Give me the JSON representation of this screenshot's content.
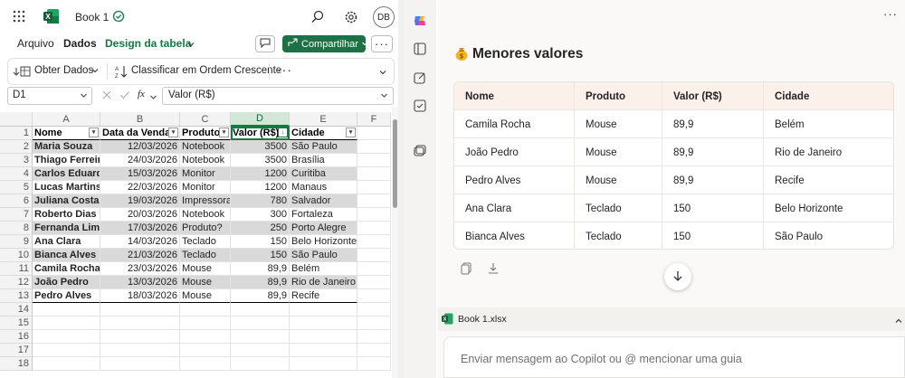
{
  "app": {
    "title": "Book 1",
    "user_initials": "DB",
    "icons": [
      "apps-grid-icon",
      "excel-logo-icon",
      "saved-status-icon",
      "search-icon",
      "settings-icon"
    ]
  },
  "ribbon": {
    "tabs": [
      "Arquivo",
      "Dados",
      "Design da tabela"
    ],
    "commands": {
      "get_data": "Obter Dados",
      "sort_asc": "Classificar em Ordem Crescente"
    }
  },
  "share_label": "Compartilhar",
  "formula_bar": {
    "name_box": "D1",
    "formula": "Valor (R$)"
  },
  "sheet": {
    "columns": [
      "A",
      "B",
      "C",
      "D",
      "E",
      "F"
    ],
    "rows": [
      "1",
      "2",
      "3",
      "4",
      "5",
      "6",
      "7",
      "8",
      "9",
      "10",
      "11",
      "12",
      "13",
      "14",
      "15",
      "16",
      "17",
      "18"
    ],
    "headers": [
      "Nome",
      "Data da Venda",
      "Produto",
      "Valor (R$)",
      "Cidade"
    ],
    "data": [
      [
        "Maria Souza",
        "12/03/2026",
        "Notebook",
        "3500",
        "São Paulo"
      ],
      [
        "Thiago Ferreira",
        "24/03/2026",
        "Notebook",
        "3500",
        "Brasília"
      ],
      [
        "Carlos Eduardo",
        "15/03/2026",
        "Monitor",
        "1200",
        "Curitiba"
      ],
      [
        "Lucas Martins",
        "22/03/2026",
        "Monitor",
        "1200",
        "Manaus"
      ],
      [
        "Juliana Costa",
        "19/03/2026",
        "Impressora",
        "780",
        "Salvador"
      ],
      [
        "Roberto Dias",
        "20/03/2026",
        "Notebook",
        "300",
        "Fortaleza"
      ],
      [
        "Fernanda Lima",
        "17/03/2026",
        "Produto?",
        "250",
        "Porto Alegre"
      ],
      [
        "Ana Clara",
        "14/03/2026",
        "Teclado",
        "150",
        "Belo Horizonte"
      ],
      [
        "Bianca Alves",
        "21/03/2026",
        "Teclado",
        "150",
        "São Paulo"
      ],
      [
        "Camila Rocha",
        "23/03/2026",
        "Mouse",
        "89,9",
        "Belém"
      ],
      [
        "João Pedro",
        "13/03/2026",
        "Mouse",
        "89,9",
        "Rio de Janeiro"
      ],
      [
        "Pedro Alves",
        "18/03/2026",
        "Mouse",
        "89,9",
        "Recife"
      ]
    ]
  },
  "copilot": {
    "title": "Menores valores",
    "table_headers": [
      "Nome",
      "Produto",
      "Valor (R$)",
      "Cidade"
    ],
    "table_rows": [
      [
        "Camila Rocha",
        "Mouse",
        "89,9",
        "Belém"
      ],
      [
        "João Pedro",
        "Mouse",
        "89,9",
        "Rio de Janeiro"
      ],
      [
        "Pedro Alves",
        "Mouse",
        "89,9",
        "Recife"
      ],
      [
        "Ana Clara",
        "Teclado",
        "150",
        "Belo Horizonte"
      ],
      [
        "Bianca Alves",
        "Teclado",
        "150",
        "São Paulo"
      ]
    ],
    "attachment": "Book 1.xlsx",
    "input_placeholder": "Enviar mensagem ao Copilot ou @ mencionar uma guia"
  },
  "colors": {
    "excel_green": "#107c41",
    "share_green": "#1e7145",
    "table_header_bg": "#fbf1ea",
    "band_gray": "#d9d9d9"
  }
}
